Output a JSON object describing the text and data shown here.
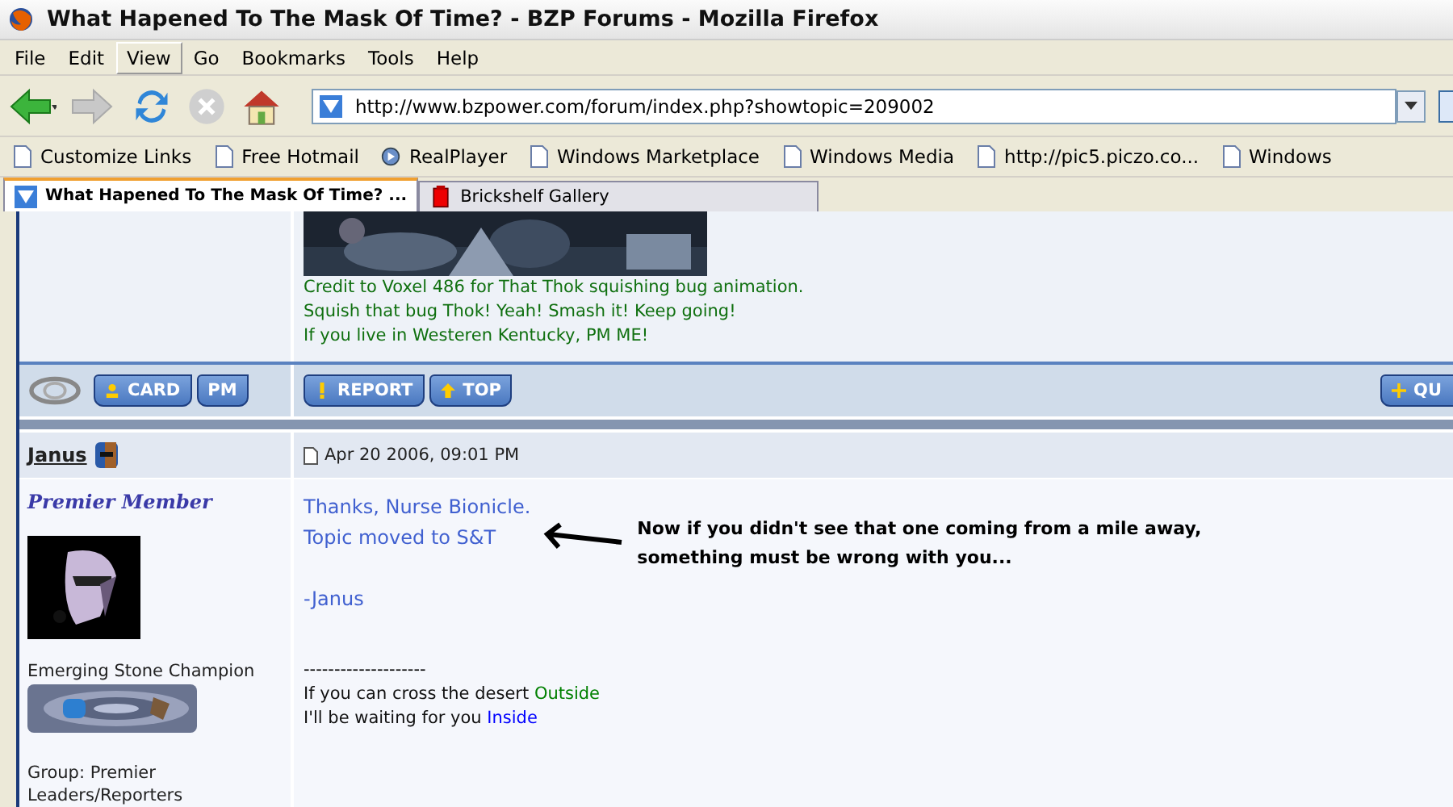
{
  "window": {
    "title": "What Hapened To The Mask Of Time? - BZP Forums - Mozilla Firefox"
  },
  "menu": [
    {
      "label": "File",
      "selected": false
    },
    {
      "label": "Edit",
      "selected": false
    },
    {
      "label": "View",
      "selected": true
    },
    {
      "label": "Go",
      "selected": false
    },
    {
      "label": "Bookmarks",
      "selected": false
    },
    {
      "label": "Tools",
      "selected": false
    },
    {
      "label": "Help",
      "selected": false
    }
  ],
  "nav_buttons": [
    {
      "kind": "back",
      "disabled": false
    },
    {
      "kind": "forward",
      "disabled": true
    },
    {
      "kind": "reload",
      "disabled": false
    },
    {
      "kind": "stop",
      "disabled": true
    },
    {
      "kind": "home",
      "disabled": false
    }
  ],
  "address": {
    "value": "http://www.bzpower.com/forum/index.php?showtopic=209002"
  },
  "bookmarks": [
    {
      "label": "Customize Links",
      "kind": "page"
    },
    {
      "label": "Free Hotmail",
      "kind": "page"
    },
    {
      "label": "RealPlayer",
      "kind": "real"
    },
    {
      "label": "Windows Marketplace",
      "kind": "page"
    },
    {
      "label": "Windows Media",
      "kind": "page"
    },
    {
      "label": "http://pic5.piczo.co...",
      "kind": "page"
    },
    {
      "label": "Windows",
      "kind": "page"
    }
  ],
  "tabs": [
    {
      "label": "What Hapened To The Mask Of Time? ...",
      "selected": true,
      "kind": "site"
    },
    {
      "label": "Brickshelf Gallery",
      "selected": false,
      "kind": "red"
    }
  ],
  "prev_post": {
    "signature": [
      "Credit to Voxel 486 for That Thok squishing bug animation.",
      "Squish that bug Thok! Yeah! Smash it! Keep going!",
      "If you live in Westeren Kentucky, PM ME!"
    ],
    "left_buttons": [
      {
        "label": "CARD",
        "kind": "card"
      },
      {
        "label": "PM",
        "kind": "plain"
      }
    ],
    "right_buttons": [
      {
        "label": "REPORT",
        "kind": "report"
      },
      {
        "label": "TOP",
        "kind": "top"
      }
    ],
    "far_button": {
      "label": "QU",
      "kind": "quote"
    }
  },
  "post": {
    "author": "Janus",
    "date": "Apr 20 2006, 09:01 PM",
    "rank": "Premier Member",
    "title": "Emerging Stone Champion",
    "group": "Group: Premier Leaders/Reporters",
    "body": [
      [
        "Thanks, Nurse Bionicle.",
        "Topic moved to S&T"
      ],
      [
        "-Janus"
      ]
    ],
    "annotation": [
      "Now if you didn't see that one coming from a mile away,",
      "something must be wrong with you..."
    ],
    "separator": "--------------------",
    "signature": [
      {
        "text": "If you can cross the desert",
        "link": "Outside",
        "color": "#008000"
      },
      {
        "text": "I'll be waiting for you",
        "link": "Inside",
        "color": "#0000ff"
      }
    ]
  }
}
